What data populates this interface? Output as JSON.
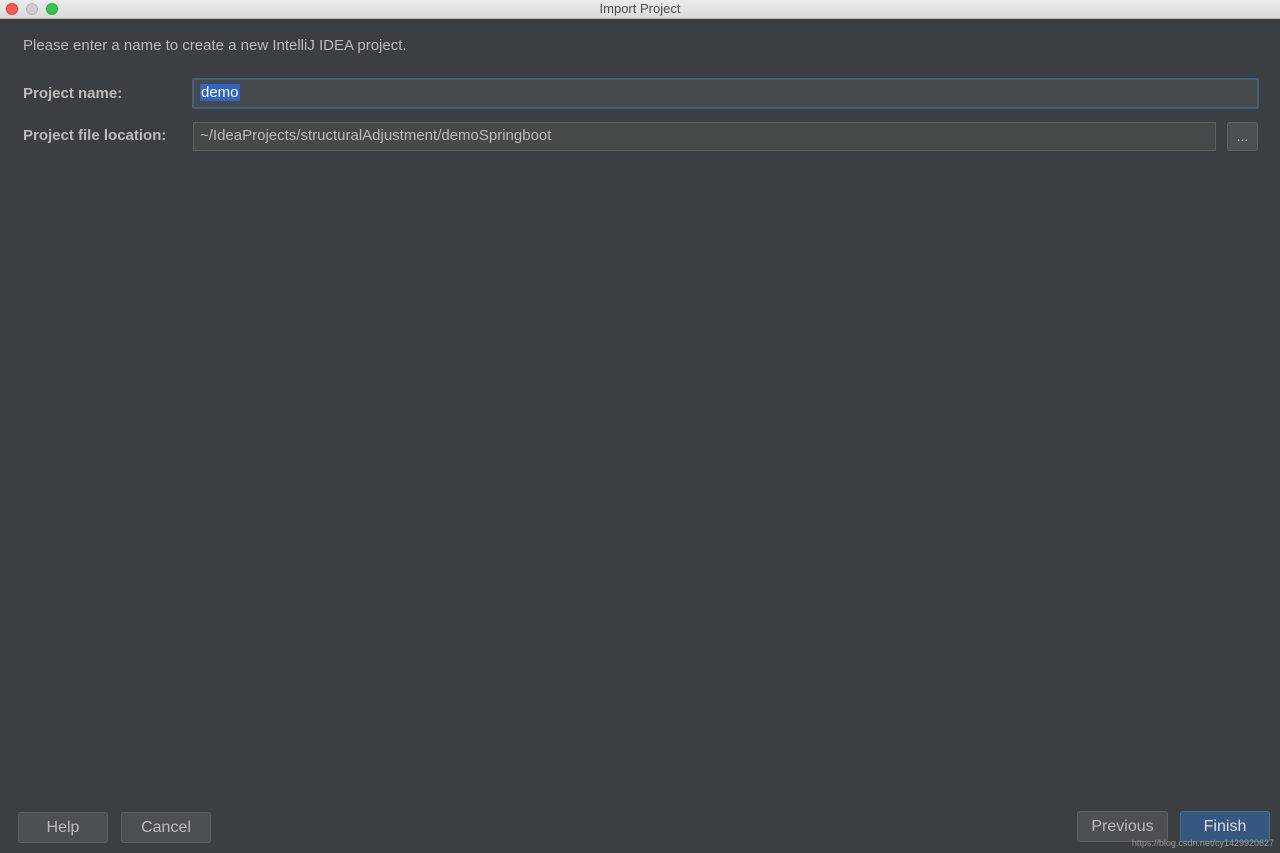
{
  "window": {
    "title": "Import Project"
  },
  "instruction": "Please enter a name to create a new IntelliJ IDEA project.",
  "project_name": {
    "label": "Project name:",
    "value": "demo"
  },
  "project_location": {
    "label": "Project file location:",
    "value": "~/IdeaProjects/structuralAdjustment/demoSpringboot",
    "browse_label": "..."
  },
  "buttons": {
    "help": "Help",
    "cancel": "Cancel",
    "previous": "Previous",
    "finish": "Finish"
  },
  "watermark": "https://blog.csdn.net/cy1429920627",
  "colors": {
    "background": "#3c3f41",
    "accent": "#365880",
    "selection": "#2f65ca",
    "focus_border": "#3d6185"
  }
}
